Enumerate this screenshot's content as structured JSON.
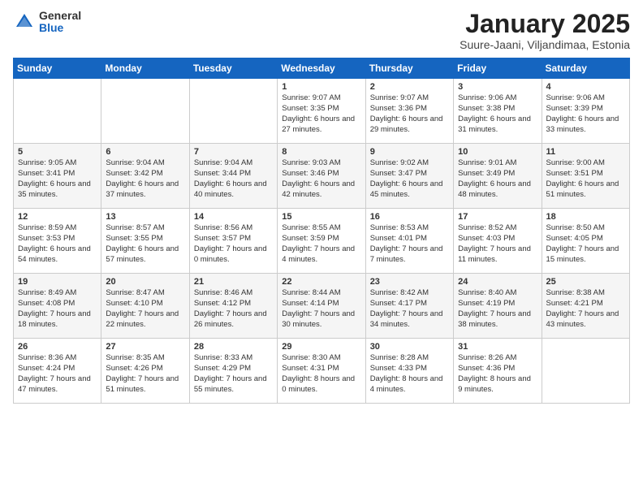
{
  "logo": {
    "general": "General",
    "blue": "Blue"
  },
  "title": "January 2025",
  "subtitle": "Suure-Jaani, Viljandimaa, Estonia",
  "days_of_week": [
    "Sunday",
    "Monday",
    "Tuesday",
    "Wednesday",
    "Thursday",
    "Friday",
    "Saturday"
  ],
  "weeks": [
    [
      {
        "day": "",
        "info": ""
      },
      {
        "day": "",
        "info": ""
      },
      {
        "day": "",
        "info": ""
      },
      {
        "day": "1",
        "info": "Sunrise: 9:07 AM\nSunset: 3:35 PM\nDaylight: 6 hours\nand 27 minutes."
      },
      {
        "day": "2",
        "info": "Sunrise: 9:07 AM\nSunset: 3:36 PM\nDaylight: 6 hours\nand 29 minutes."
      },
      {
        "day": "3",
        "info": "Sunrise: 9:06 AM\nSunset: 3:38 PM\nDaylight: 6 hours\nand 31 minutes."
      },
      {
        "day": "4",
        "info": "Sunrise: 9:06 AM\nSunset: 3:39 PM\nDaylight: 6 hours\nand 33 minutes."
      }
    ],
    [
      {
        "day": "5",
        "info": "Sunrise: 9:05 AM\nSunset: 3:41 PM\nDaylight: 6 hours\nand 35 minutes."
      },
      {
        "day": "6",
        "info": "Sunrise: 9:04 AM\nSunset: 3:42 PM\nDaylight: 6 hours\nand 37 minutes."
      },
      {
        "day": "7",
        "info": "Sunrise: 9:04 AM\nSunset: 3:44 PM\nDaylight: 6 hours\nand 40 minutes."
      },
      {
        "day": "8",
        "info": "Sunrise: 9:03 AM\nSunset: 3:46 PM\nDaylight: 6 hours\nand 42 minutes."
      },
      {
        "day": "9",
        "info": "Sunrise: 9:02 AM\nSunset: 3:47 PM\nDaylight: 6 hours\nand 45 minutes."
      },
      {
        "day": "10",
        "info": "Sunrise: 9:01 AM\nSunset: 3:49 PM\nDaylight: 6 hours\nand 48 minutes."
      },
      {
        "day": "11",
        "info": "Sunrise: 9:00 AM\nSunset: 3:51 PM\nDaylight: 6 hours\nand 51 minutes."
      }
    ],
    [
      {
        "day": "12",
        "info": "Sunrise: 8:59 AM\nSunset: 3:53 PM\nDaylight: 6 hours\nand 54 minutes."
      },
      {
        "day": "13",
        "info": "Sunrise: 8:57 AM\nSunset: 3:55 PM\nDaylight: 6 hours\nand 57 minutes."
      },
      {
        "day": "14",
        "info": "Sunrise: 8:56 AM\nSunset: 3:57 PM\nDaylight: 7 hours\nand 0 minutes."
      },
      {
        "day": "15",
        "info": "Sunrise: 8:55 AM\nSunset: 3:59 PM\nDaylight: 7 hours\nand 4 minutes."
      },
      {
        "day": "16",
        "info": "Sunrise: 8:53 AM\nSunset: 4:01 PM\nDaylight: 7 hours\nand 7 minutes."
      },
      {
        "day": "17",
        "info": "Sunrise: 8:52 AM\nSunset: 4:03 PM\nDaylight: 7 hours\nand 11 minutes."
      },
      {
        "day": "18",
        "info": "Sunrise: 8:50 AM\nSunset: 4:05 PM\nDaylight: 7 hours\nand 15 minutes."
      }
    ],
    [
      {
        "day": "19",
        "info": "Sunrise: 8:49 AM\nSunset: 4:08 PM\nDaylight: 7 hours\nand 18 minutes."
      },
      {
        "day": "20",
        "info": "Sunrise: 8:47 AM\nSunset: 4:10 PM\nDaylight: 7 hours\nand 22 minutes."
      },
      {
        "day": "21",
        "info": "Sunrise: 8:46 AM\nSunset: 4:12 PM\nDaylight: 7 hours\nand 26 minutes."
      },
      {
        "day": "22",
        "info": "Sunrise: 8:44 AM\nSunset: 4:14 PM\nDaylight: 7 hours\nand 30 minutes."
      },
      {
        "day": "23",
        "info": "Sunrise: 8:42 AM\nSunset: 4:17 PM\nDaylight: 7 hours\nand 34 minutes."
      },
      {
        "day": "24",
        "info": "Sunrise: 8:40 AM\nSunset: 4:19 PM\nDaylight: 7 hours\nand 38 minutes."
      },
      {
        "day": "25",
        "info": "Sunrise: 8:38 AM\nSunset: 4:21 PM\nDaylight: 7 hours\nand 43 minutes."
      }
    ],
    [
      {
        "day": "26",
        "info": "Sunrise: 8:36 AM\nSunset: 4:24 PM\nDaylight: 7 hours\nand 47 minutes."
      },
      {
        "day": "27",
        "info": "Sunrise: 8:35 AM\nSunset: 4:26 PM\nDaylight: 7 hours\nand 51 minutes."
      },
      {
        "day": "28",
        "info": "Sunrise: 8:33 AM\nSunset: 4:29 PM\nDaylight: 7 hours\nand 55 minutes."
      },
      {
        "day": "29",
        "info": "Sunrise: 8:30 AM\nSunset: 4:31 PM\nDaylight: 8 hours\nand 0 minutes."
      },
      {
        "day": "30",
        "info": "Sunrise: 8:28 AM\nSunset: 4:33 PM\nDaylight: 8 hours\nand 4 minutes."
      },
      {
        "day": "31",
        "info": "Sunrise: 8:26 AM\nSunset: 4:36 PM\nDaylight: 8 hours\nand 9 minutes."
      },
      {
        "day": "",
        "info": ""
      }
    ]
  ]
}
